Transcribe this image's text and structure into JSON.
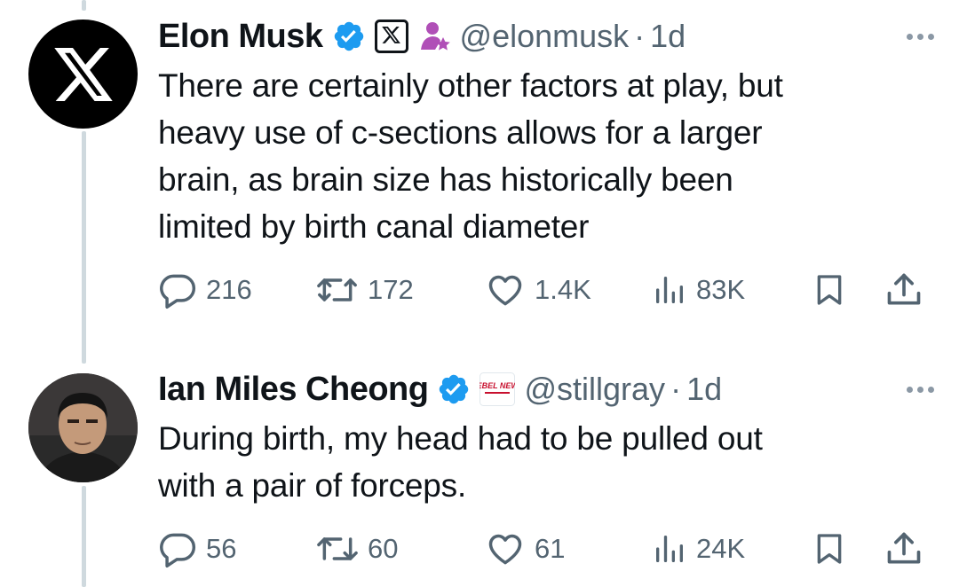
{
  "tweets": [
    {
      "name": "Elon Musk",
      "handle": "@elonmusk",
      "dot": "·",
      "time": "1d",
      "avatar_icon": "x-logo-icon",
      "text": "There are certainly other factors at play, but\nheavy use of c-sections allows for a larger\nbrain, as brain size has historically been\nlimited by birth canal diameter",
      "replies": "216",
      "reposts": "172",
      "likes": "1.4K",
      "views": "83K"
    },
    {
      "name": "Ian Miles Cheong",
      "handle": "@stillgray",
      "dot": "·",
      "time": "1d",
      "affiliate_badge": "REBEL NEWS",
      "text": "During birth, my head had to be pulled out\nwith a pair of forceps.",
      "replies": "56",
      "reposts": "60",
      "likes": "61",
      "views": "24K"
    }
  ],
  "colors": {
    "verified": "#1d9bf0",
    "secondary_text": "#536471",
    "thread_line": "#cfd9de",
    "rebel_red": "#c8102e"
  }
}
